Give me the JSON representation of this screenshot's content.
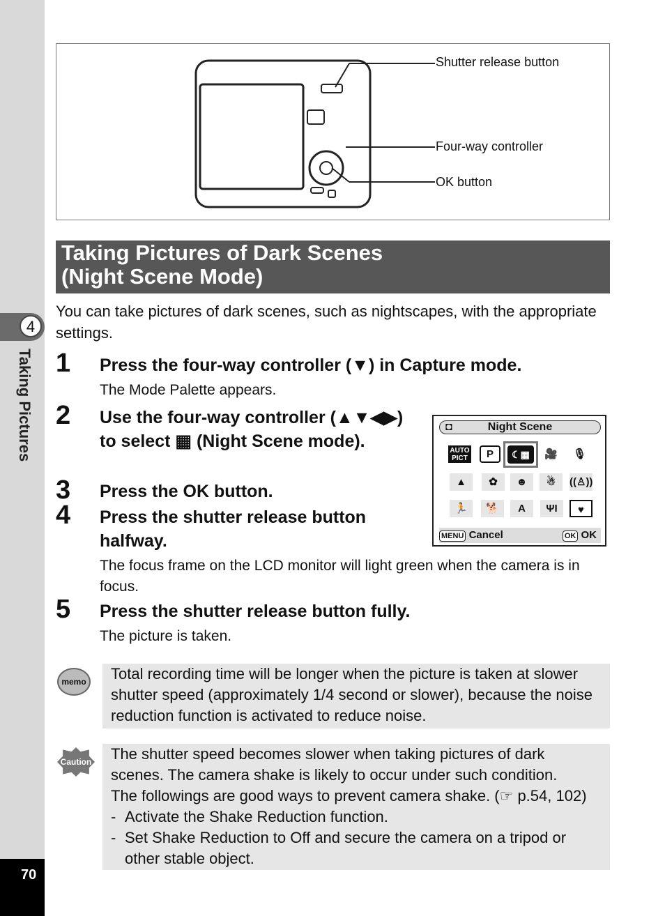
{
  "sidebar": {
    "chapter_number": "4",
    "chapter_title": "Taking Pictures",
    "page_number": "70"
  },
  "figure": {
    "callouts": [
      "Shutter release button",
      "Four-way controller",
      "OK button"
    ]
  },
  "title": {
    "line1": "Taking Pictures of Dark Scenes",
    "line2": "(Night Scene Mode)"
  },
  "intro": "You can take pictures of dark scenes, such as nightscapes, with the appropriate settings.",
  "steps": [
    {
      "num": "1",
      "text": "Press the four-way controller (▼) in Capture mode.",
      "sub": "The Mode Palette appears."
    },
    {
      "num": "2",
      "text": "Use the four-way controller (▲▼◀▶) to select ▦ (Night Scene mode)."
    },
    {
      "num": "3",
      "text": "Press the OK button."
    },
    {
      "num": "4",
      "text": "Press the shutter release button halfway.",
      "sub": "The focus frame on the LCD monitor will light green when the camera is in focus."
    },
    {
      "num": "5",
      "text": "Press the shutter release button fully.",
      "sub": "The picture is taken."
    }
  ],
  "palette": {
    "header": "Night Scene",
    "selected": "night-scene",
    "icons": [
      [
        "AUTO PICT",
        "P",
        "night-scene",
        "movie",
        "voice"
      ],
      [
        "landscape",
        "flower",
        "portrait",
        "snow",
        "sound"
      ],
      [
        "sport",
        "pet",
        "text",
        "food",
        "frame"
      ]
    ],
    "menu_key": "MENU",
    "cancel": "Cancel",
    "ok_key": "OK",
    "ok": "OK"
  },
  "memo": {
    "icon_label": "memo",
    "text": "Total recording time will be longer when the picture is taken at slower shutter speed (approximately 1/4 second or slower), because the noise reduction function is activated to reduce noise."
  },
  "caution": {
    "icon_label": "Caution",
    "lines": [
      "The shutter speed becomes slower when taking pictures of dark scenes. The camera shake is likely to occur under such condition.",
      "The followings are good ways to prevent camera shake. (☞ p.54, 102)"
    ],
    "bullets": [
      "Activate the Shake Reduction function.",
      "Set Shake Reduction to Off and secure the camera on a tripod or other stable object."
    ]
  }
}
